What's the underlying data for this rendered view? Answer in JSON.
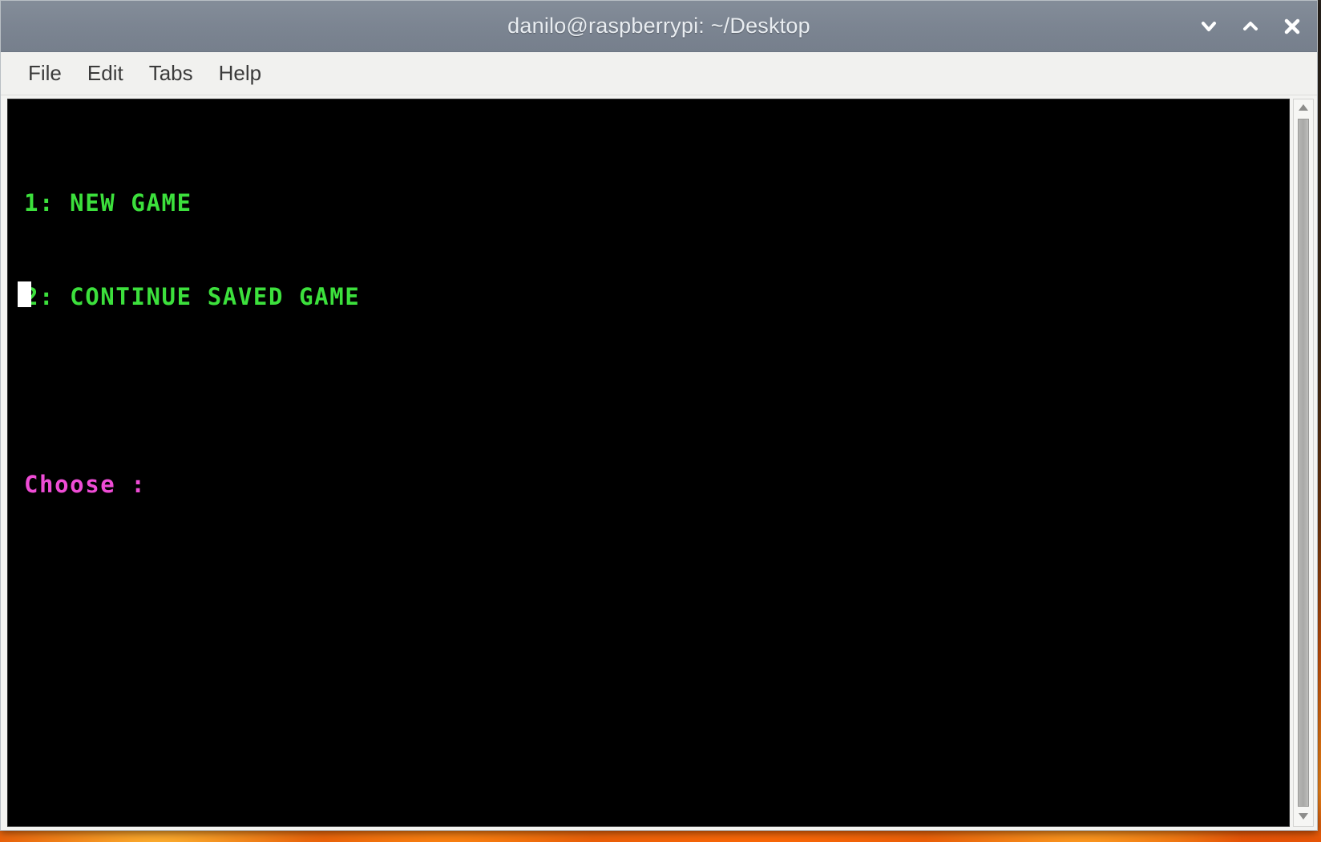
{
  "window": {
    "title": "danilo@raspberrypi: ~/Desktop",
    "controls": [
      {
        "name": "minimize-button",
        "glyph": "chevron-down-icon",
        "label": "Minimize"
      },
      {
        "name": "maximize-button",
        "glyph": "chevron-up-icon",
        "label": "Maximize"
      },
      {
        "name": "close-button",
        "glyph": "close-x-icon",
        "label": "Close"
      }
    ]
  },
  "menubar": {
    "items": [
      {
        "label": "File"
      },
      {
        "label": "Edit"
      },
      {
        "label": "Tabs"
      },
      {
        "label": "Help"
      }
    ]
  },
  "terminal": {
    "lines": [
      {
        "text": "1: NEW GAME",
        "color": "green"
      },
      {
        "text": "2: CONTINUE SAVED GAME",
        "color": "green"
      },
      {
        "text": "",
        "color": "blank"
      },
      {
        "text": "Choose :",
        "color": "magenta"
      }
    ],
    "cursor": {
      "visible": true,
      "shape": "block",
      "color": "#ffffff"
    },
    "colors": {
      "background": "#000000",
      "green": "#3ce03c",
      "magenta": "#ef4cd6",
      "cursor": "#ffffff"
    }
  },
  "scrollbar": {
    "up_arrow_label": "Scroll up",
    "down_arrow_label": "Scroll down",
    "thumb_label": "Scroll thumb"
  },
  "theme": {
    "titlebar_bg": "#7c8592",
    "titlebar_text": "#e9edf1",
    "menubar_bg": "#f1f1ef",
    "menubar_text": "#3b3b3b",
    "window_border": "#b9bfc4",
    "desktop_accent": "#ff8c1a"
  }
}
